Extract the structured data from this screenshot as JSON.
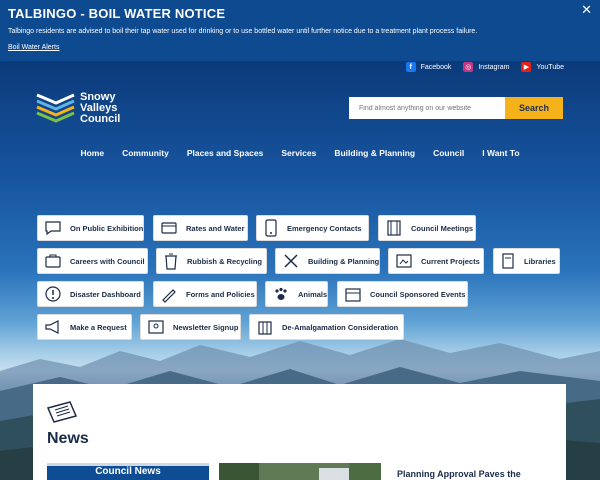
{
  "alert": {
    "title": "TALBINGO - BOIL WATER NOTICE",
    "text": "Talbingo residents are advised to boil their tap water used for drinking or to use bottled water until further notice due to a treatment plant process failure.",
    "link": "Boil Water Alerts",
    "close": "✕"
  },
  "social": [
    {
      "label": "Facebook",
      "icon": "facebook-icon",
      "color": "#1877f2"
    },
    {
      "label": "Instagram",
      "icon": "instagram-icon",
      "color": "#c13584"
    },
    {
      "label": "YouTube",
      "icon": "youtube-icon",
      "color": "#e62117"
    }
  ],
  "logo": {
    "line1": "Snowy",
    "line2": "Valleys",
    "line3": "Council"
  },
  "search": {
    "placeholder": "Find almost anything on our website",
    "button": "Search"
  },
  "nav": [
    "Home",
    "Community",
    "Places and Spaces",
    "Services",
    "Building & Planning",
    "Council",
    "I Want To"
  ],
  "quick_links": [
    {
      "label": "On Public Exhibition",
      "icon": "speech-bubble-icon"
    },
    {
      "label": "Rates and Water",
      "icon": "payment-icon"
    },
    {
      "label": "Emergency Contacts",
      "icon": "phone-icon"
    },
    {
      "label": "Council Meetings",
      "icon": "film-icon"
    },
    {
      "label": "Careers with Council",
      "icon": "briefcase-icon"
    },
    {
      "label": "Rubbish & Recycling",
      "icon": "bin-icon"
    },
    {
      "label": "Building & Planning",
      "icon": "tools-icon"
    },
    {
      "label": "Current Projects",
      "icon": "projects-icon"
    },
    {
      "label": "Libraries",
      "icon": "book-icon"
    },
    {
      "label": "Disaster Dashboard",
      "icon": "alert-icon"
    },
    {
      "label": "Forms and Policies",
      "icon": "pen-icon"
    },
    {
      "label": "Animals",
      "icon": "paw-icon"
    },
    {
      "label": "Council Sponsored Events",
      "icon": "calendar-icon"
    },
    {
      "label": "Make a Request",
      "icon": "megaphone-icon"
    },
    {
      "label": "Newsletter Signup",
      "icon": "newsletter-icon"
    },
    {
      "label": "De-Amalgamation Consideration",
      "icon": "building-icon"
    }
  ],
  "news": {
    "title": "News",
    "card1": "Council News",
    "card3_title": "Planning Approval Paves the"
  },
  "colors": {
    "accent": "#f6b21b",
    "brand_blue": "#0d4a8f",
    "text_dark": "#1b2b48"
  }
}
